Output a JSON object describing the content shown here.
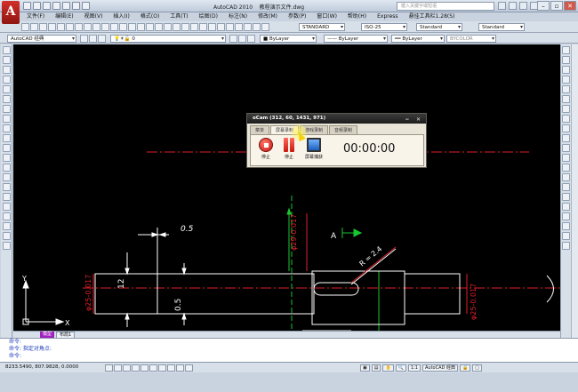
{
  "window": {
    "app_title": "AutoCAD 2010",
    "file_title": "教程演示文件.dwg",
    "search_placeholder": "键入关键字或短语"
  },
  "menu": [
    "文件(F)",
    "编辑(E)",
    "视图(V)",
    "插入(I)",
    "格式(O)",
    "工具(T)",
    "绘图(D)",
    "标注(N)",
    "修改(M)",
    "参数(P)",
    "窗口(W)",
    "帮助(H)",
    "Express",
    "悬挂工具栏1.28(S)"
  ],
  "toolbar1": {
    "text_style": "STANDARD",
    "dim_style": "ISO-25",
    "table_style": "Standard",
    "multileader_style": "Standard"
  },
  "toolbar2": {
    "workspace": "AutoCAD 经典",
    "layer": "0",
    "color": "ByLayer",
    "linetype": "ByLayer",
    "lineweight": "ByLayer",
    "plot_style": "BYCOLOR"
  },
  "drawing": {
    "dim_05_top": "0.5",
    "dim_12": "12",
    "dim_05_mid": "0.5",
    "dim_left_dia": "φ25-0.017",
    "dim_center_dia": "φ29-0.017",
    "dim_r": "R = 2.4",
    "dim_right_dia": "φ25-0.017",
    "section_label": "A",
    "ucs_y": "Y",
    "ucs_x": "X"
  },
  "tabs": {
    "model": "模型",
    "layout1": "布局1"
  },
  "command": {
    "line1": "命令:",
    "line2": "命令: 指定对角点:",
    "line3": "命令:"
  },
  "status": {
    "coords": "8233.5490, 807.9828, 0.0000",
    "scale": "1:1",
    "workspace": "AutoCAD 经典"
  },
  "ocam": {
    "title": "oCam (312, 60, 1431, 971)",
    "tabs": [
      "菜单",
      "屏幕录制",
      "游戏录制",
      "音频录制"
    ],
    "active_tab_index": 1,
    "stop_label": "停止",
    "pause_label": "停止",
    "screen_label": "屏幕捕获",
    "timer": "00:00:00"
  },
  "colors": {
    "canvas_bg": "#000000",
    "dim_red": "#e0202a",
    "dim_green": "#19c630",
    "geom_white": "#ffffff",
    "magenta": "#c830d8"
  }
}
